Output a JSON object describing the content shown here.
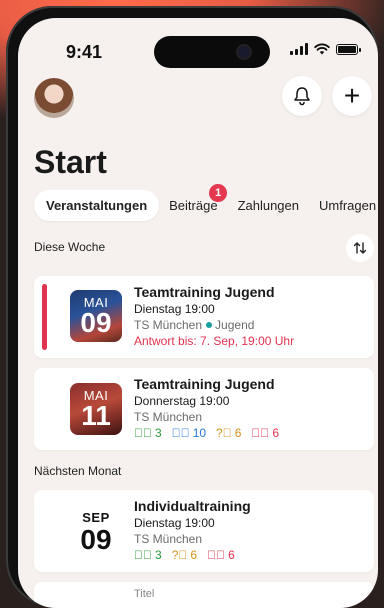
{
  "status_bar": {
    "time": "9:41"
  },
  "header": {
    "title": "Start"
  },
  "tabs": [
    {
      "label": "Veranstaltungen",
      "active": true
    },
    {
      "label": "Beiträge",
      "badge": "1"
    },
    {
      "label": "Zahlungen"
    },
    {
      "label": "Umfragen"
    }
  ],
  "sections": {
    "this_week": "Diese Woche",
    "next_month": "Nächsten Monat"
  },
  "events": [
    {
      "month": "MAI",
      "day": "09",
      "title": "Teamtraining Jugend",
      "time": "Dienstag 19:00",
      "location": "TS München",
      "group": "Jugend",
      "reply": "Antwort bis: 7. Sep, 19:00 Uhr"
    },
    {
      "month": "MAI",
      "day": "11",
      "title": "Teamtraining Jugend",
      "time": "Donnerstag 19:00",
      "location": "TS München",
      "stats": {
        "yes": "3",
        "info": "10",
        "maybe": "6",
        "no": "6"
      }
    },
    {
      "month": "SEP",
      "day": "09",
      "title": "Individualtraining",
      "time": "Dienstag 19:00",
      "location": "TS München",
      "stats": {
        "yes": "3",
        "maybe": "6",
        "no": "6"
      }
    },
    {
      "title": "Titel"
    }
  ],
  "colors": {
    "accent_red": "#e0334f",
    "background": "#f6f1ee",
    "ok_green": "#2d9a3a",
    "info_blue": "#2a78d8",
    "maybe_orange": "#d4921c"
  },
  "icons": {
    "notifications": "bell-icon",
    "add": "plus-icon",
    "sort": "sort-icon"
  }
}
